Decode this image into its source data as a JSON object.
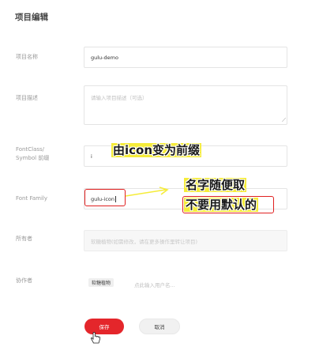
{
  "page": {
    "title": "项目编辑"
  },
  "form": {
    "name": {
      "label": "项目名称",
      "value": "gulu-demo"
    },
    "description": {
      "label": "项目描述",
      "placeholder": "请输入项目描述（可选）",
      "resize_glyph": "⟋"
    },
    "fontclass": {
      "label_line1": "FontClass/",
      "label_line2": "Symbol 前缀",
      "value": "i"
    },
    "font_family": {
      "label": "Font Family",
      "value": "gulu-icon"
    },
    "owner": {
      "label": "所有者",
      "placeholder": "软糖植物(如需修改，请在更多操作里转让项目)"
    },
    "collaborators": {
      "label": "协作者",
      "tag": "软糖植物",
      "placeholder": "点此输入用户名..."
    }
  },
  "buttons": {
    "save": "保存",
    "cancel": "取消"
  },
  "annotations": {
    "prefix_note": "由icon变为前缀",
    "name_note_line1": "名字随便取",
    "name_note_line2": "不要用默认的"
  },
  "colors": {
    "accent": "#e4262b",
    "annotation_bg": "#f5ec3a",
    "annotation_border": "#e02020"
  },
  "icons": {
    "cursor": "hand-pointer-icon",
    "resize": "resize-handle-icon"
  }
}
